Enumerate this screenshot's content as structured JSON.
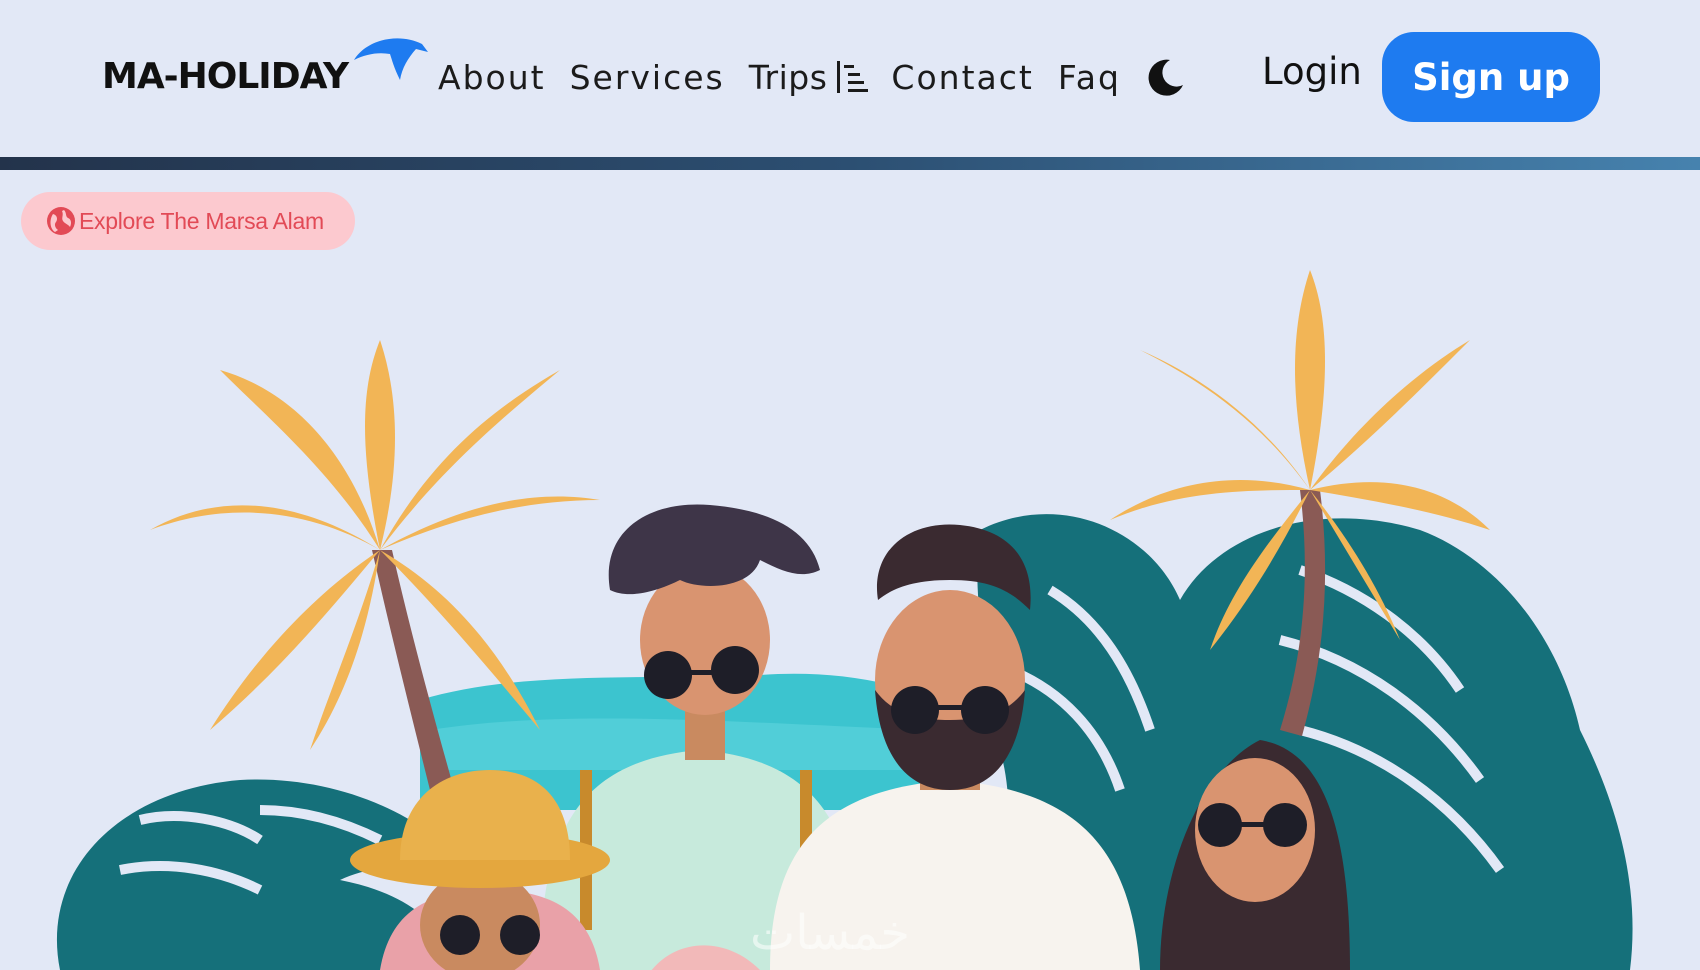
{
  "header": {
    "logo_text": "MA-HOLIDAY",
    "nav": [
      {
        "label": "About"
      },
      {
        "label": "Services"
      },
      {
        "label": "Trips",
        "icon": "list-indent-icon"
      },
      {
        "label": "Contact"
      },
      {
        "label": "Faq"
      }
    ],
    "theme_toggle_icon": "moon-icon",
    "login_label": "Login",
    "signup_label": "Sign up"
  },
  "badge": {
    "icon": "globe-icon",
    "label": "Explore The Marsa Alam"
  },
  "hero": {
    "illustration": "travelers-palm-trees-illustration"
  },
  "watermark": {
    "text": "خمسات"
  },
  "colors": {
    "background": "#e2e8f6",
    "accent": "#1e7bf0",
    "badge_bg": "#fcc9cf",
    "badge_text": "#e24a56",
    "palm_leaf": "#f2b556",
    "monstera": "#15707a",
    "sea": "#3cc4cf"
  }
}
